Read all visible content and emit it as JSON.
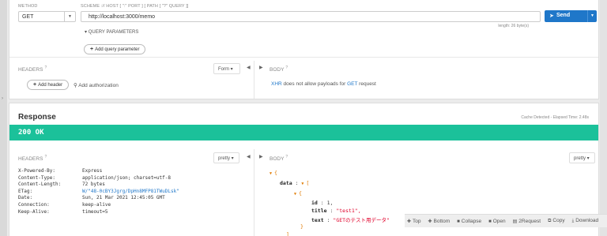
{
  "request": {
    "method_label": "METHOD",
    "url_label": "SCHEME :// HOST [ \":\" PORT ] [ PATH [ \"?\" QUERY ]]",
    "method": "GET",
    "url": "http://localhost:3000/memo",
    "url_length": "length: 26 byte(s)",
    "send_label": "Send",
    "query_params_label": "QUERY PARAMETERS",
    "add_query_param": "Add query parameter",
    "headers_title": "HEADERS",
    "form_label": "Form",
    "body_title": "BODY",
    "add_header": "Add header",
    "add_authorization": "Add authorization",
    "body_note_prefix": "XHR",
    "body_note_middle": " does not allow payloads for ",
    "body_note_method": "GET",
    "body_note_suffix": " request"
  },
  "response": {
    "title": "Response",
    "meta": "Cache Detected - Elapsed Time: 2.48s",
    "status": "200 OK",
    "headers_title": "HEADERS",
    "pretty_label": "pretty",
    "body_title": "BODY",
    "headers": [
      {
        "key": "X-Powered-By:",
        "value": "Express"
      },
      {
        "key": "Content-Type:",
        "value": "application/json; charset=utf-8"
      },
      {
        "key": "Content-Length:",
        "value": "72 bytes"
      },
      {
        "key": "ETag:",
        "value": "W/\"48-0cBY3Jgrg/DpHn8MFP81TWuDLsk\""
      },
      {
        "key": "Date:",
        "value": "Sun, 21 Mar 2021 12:45:05 GMT"
      },
      {
        "key": "Connection:",
        "value": "keep-alive"
      },
      {
        "key": "Keep-Alive:",
        "value": "timeout=5"
      }
    ],
    "json": {
      "open_brace": "{",
      "data_key": "data",
      "array_open": "[",
      "obj_open": "{",
      "id_key": "id",
      "id_value": "1,",
      "title_key": "title",
      "title_value": "\"test1\",",
      "text_key": "text",
      "text_value": "\"GETのテスト用データ\"",
      "obj_close": "}",
      "array_close": "]"
    },
    "toolbar": [
      "Top",
      "Bottom",
      "Collapse",
      "Open",
      "2Request",
      "Copy",
      "Download"
    ]
  },
  "colors": {
    "accent": "#1f77c9",
    "status": "#1bc19a",
    "brace": "#e07a00",
    "string": "#e0002a"
  }
}
